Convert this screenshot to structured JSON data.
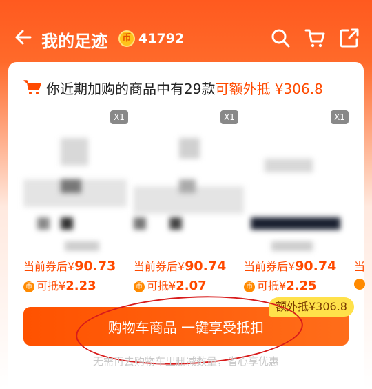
{
  "header": {
    "title": "我的足迹",
    "coin_symbol": "币",
    "coin_count": "41792",
    "icons": [
      "back-arrow-icon",
      "search-icon",
      "cart-icon",
      "share-icon"
    ],
    "background": "#ff5a1f"
  },
  "promo": {
    "text": "你近期加购的商品中有29款",
    "highlight": "可额外抵 ¥306.8",
    "accent": "#ff4a00"
  },
  "products": [
    {
      "qty": "X1",
      "price_prefix": "当前券后",
      "currency": "¥",
      "price": "90.73",
      "offset_label": "可抵",
      "offset": "2.23"
    },
    {
      "qty": "X1",
      "price_prefix": "当前券后",
      "currency": "¥",
      "price": "90.74",
      "offset_label": "可抵",
      "offset": "2.07"
    },
    {
      "qty": "X1",
      "price_prefix": "当前券后",
      "currency": "¥",
      "price": "90.74",
      "offset_label": "可抵",
      "offset": "2.25"
    }
  ],
  "partial_product": {
    "price_prefix": "当"
  },
  "badge": "额外抵¥306.8",
  "cta_label": "购物车商品 一键享受抵扣",
  "footer": "无需再去购物车里删减数量，省心享优惠"
}
